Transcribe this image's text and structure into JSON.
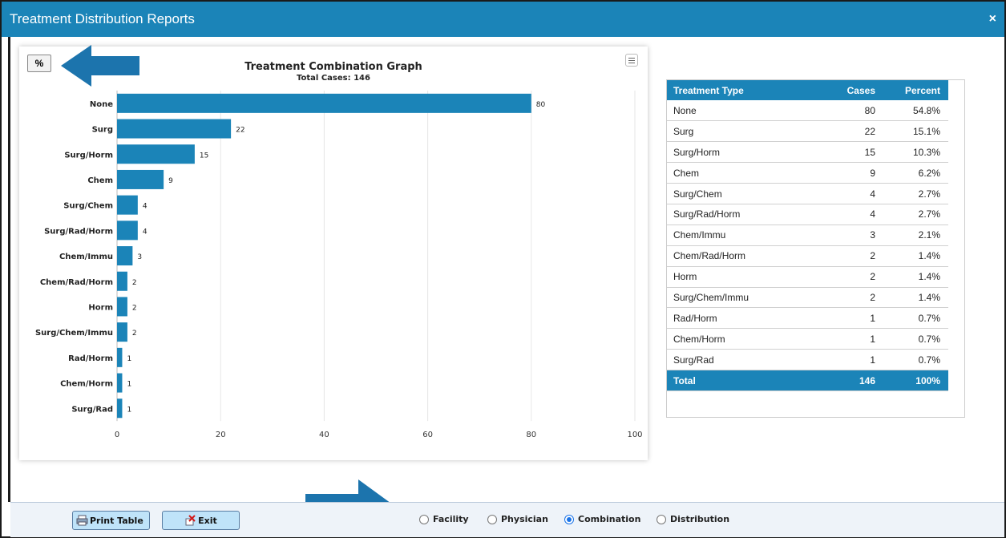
{
  "window": {
    "title": "Treatment Distribution Reports",
    "close_label": "×"
  },
  "chart_controls": {
    "percent_label": "%",
    "menu_icon": "hamburger-menu-icon"
  },
  "chart_data": {
    "type": "bar",
    "orientation": "horizontal",
    "title": "Treatment Combination Graph",
    "subtitle": "Total Cases: 146",
    "categories": [
      "None",
      "Surg",
      "Surg/Horm",
      "Chem",
      "Surg/Chem",
      "Surg/Rad/Horm",
      "Chem/Immu",
      "Chem/Rad/Horm",
      "Horm",
      "Surg/Chem/Immu",
      "Rad/Horm",
      "Chem/Horm",
      "Surg/Rad"
    ],
    "values": [
      80,
      22,
      15,
      9,
      4,
      4,
      3,
      2,
      2,
      2,
      1,
      1,
      1
    ],
    "xlim": [
      0,
      100
    ],
    "xticks": [
      0,
      20,
      40,
      60,
      80,
      100
    ],
    "grid": true,
    "bar_color": "#1b84b8"
  },
  "table": {
    "headers": [
      "Treatment Type",
      "Cases",
      "Percent"
    ],
    "rows": [
      [
        "None",
        "80",
        "54.8%"
      ],
      [
        "Surg",
        "22",
        "15.1%"
      ],
      [
        "Surg/Horm",
        "15",
        "10.3%"
      ],
      [
        "Chem",
        "9",
        "6.2%"
      ],
      [
        "Surg/Chem",
        "4",
        "2.7%"
      ],
      [
        "Surg/Rad/Horm",
        "4",
        "2.7%"
      ],
      [
        "Chem/Immu",
        "3",
        "2.1%"
      ],
      [
        "Chem/Rad/Horm",
        "2",
        "1.4%"
      ],
      [
        "Horm",
        "2",
        "1.4%"
      ],
      [
        "Surg/Chem/Immu",
        "2",
        "1.4%"
      ],
      [
        "Rad/Horm",
        "1",
        "0.7%"
      ],
      [
        "Chem/Horm",
        "1",
        "0.7%"
      ],
      [
        "Surg/Rad",
        "1",
        "0.7%"
      ]
    ],
    "total": [
      "Total",
      "146",
      "100%"
    ]
  },
  "footer": {
    "print_label": "Print Table",
    "exit_label": "Exit",
    "radios": [
      {
        "label": "Facility",
        "checked": false
      },
      {
        "label": "Physician",
        "checked": false
      },
      {
        "label": "Combination",
        "checked": true
      },
      {
        "label": "Distribution",
        "checked": false
      }
    ]
  },
  "colors": {
    "accent": "#1b84b8",
    "annotation_arrow": "#1c74ad"
  }
}
